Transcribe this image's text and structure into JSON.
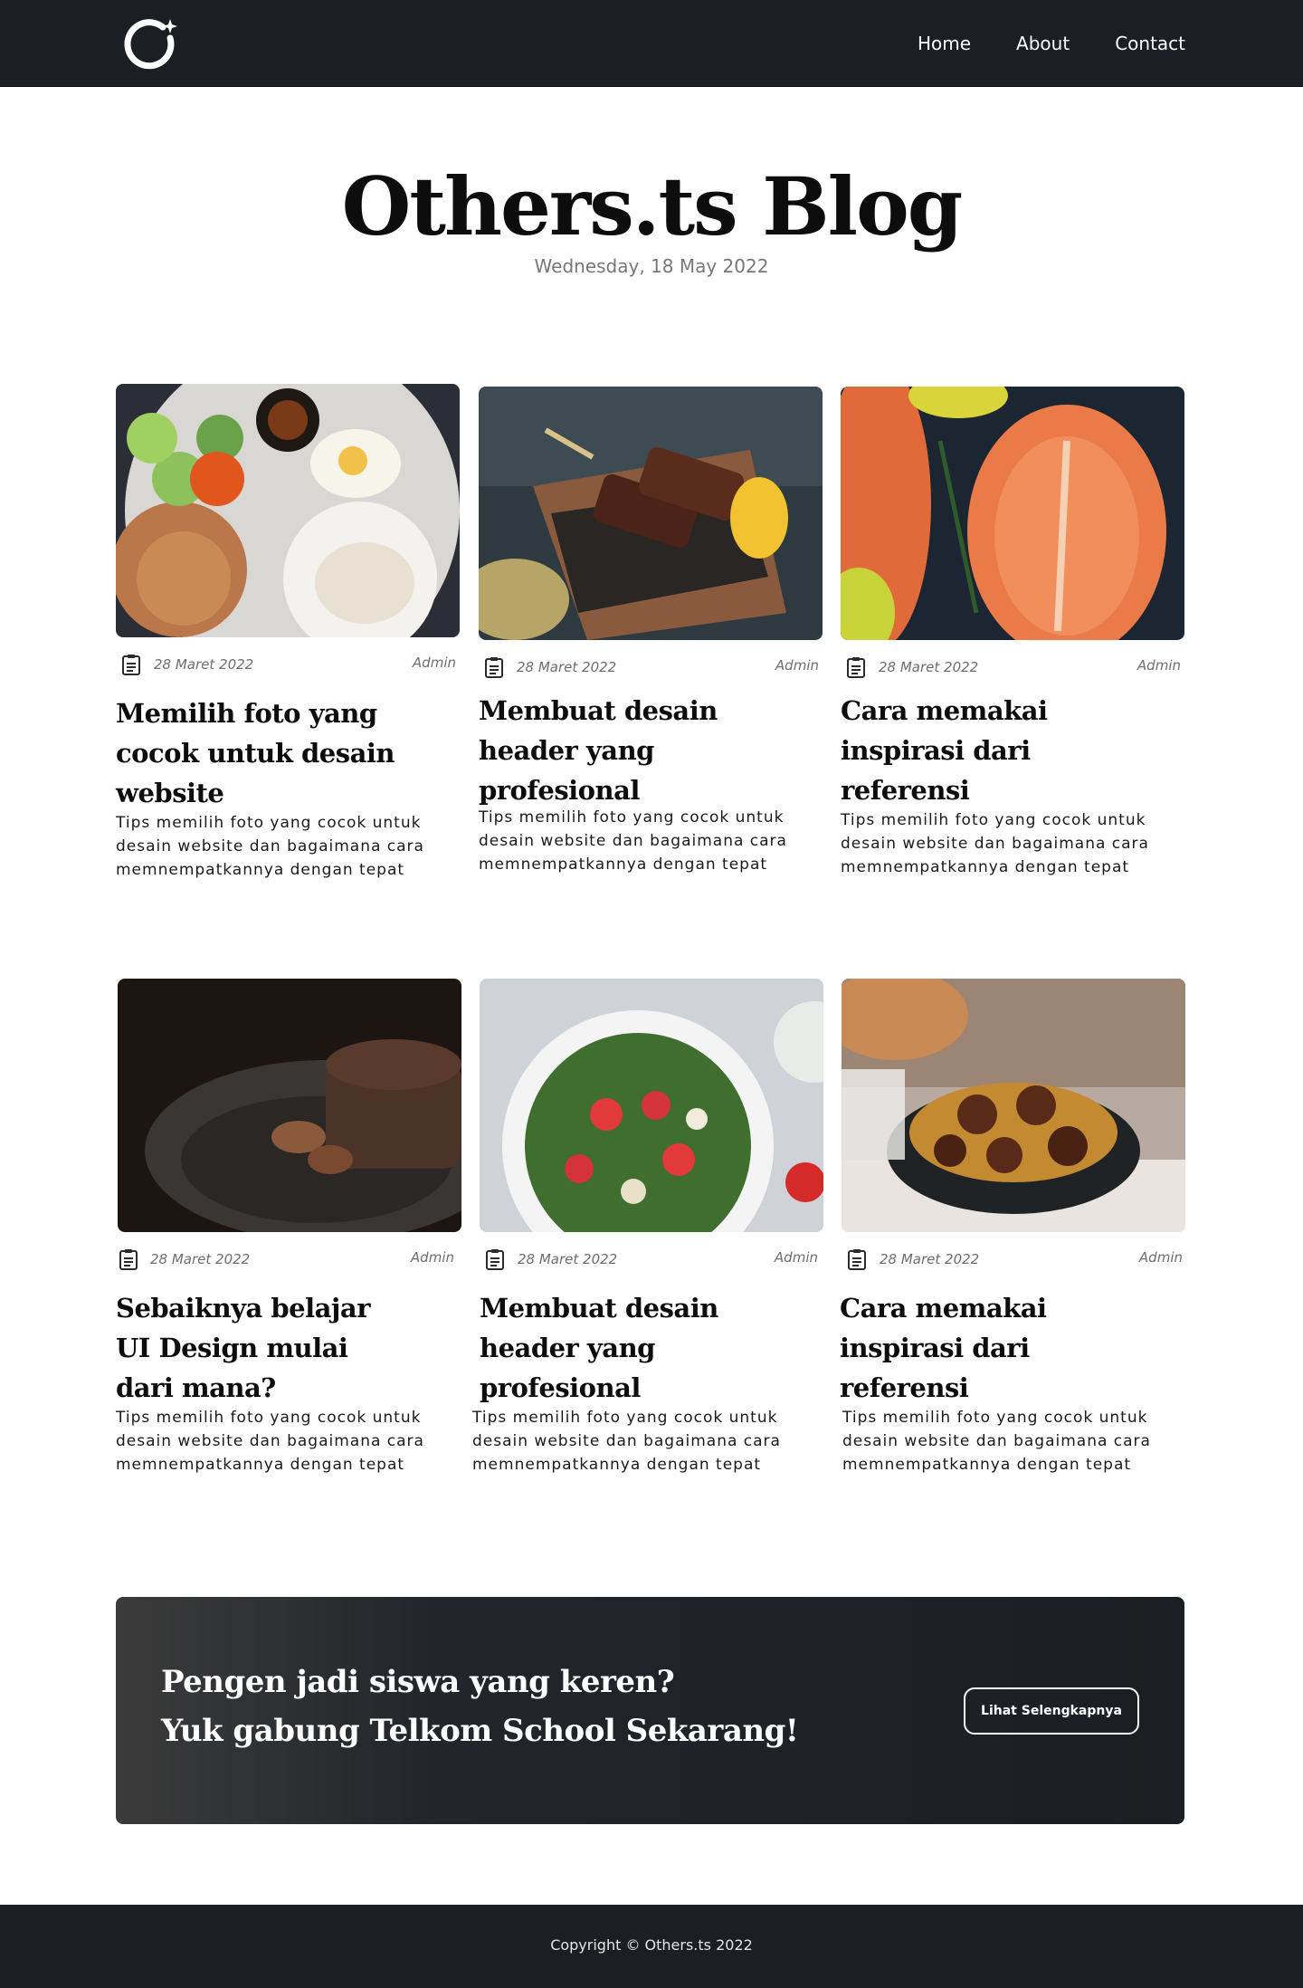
{
  "nav": {
    "logo_icon": "circle-sparkle-logo",
    "links": [
      {
        "label": "Home"
      },
      {
        "label": "About"
      },
      {
        "label": "Contact"
      }
    ]
  },
  "hero": {
    "title": "Others.ts Blog",
    "date": "Wednesday, 18 May 2022"
  },
  "posts": [
    {
      "image": "nasi-goreng-plate-photo",
      "date": "28 Maret 2022",
      "author": "Admin",
      "title": "Memilih foto yang cocok untuk desain website",
      "description": "Tips memilih foto yang cocok untuk desain website dan bagaimana cara memnempatkannya dengan tepat"
    },
    {
      "image": "grilled-satay-photo",
      "date": "28 Maret 2022",
      "author": "Admin",
      "title": "Membuat desain header yang profesional",
      "description": "Tips memilih foto yang cocok untuk desain website dan bagaimana cara memnempatkannya dengan tepat"
    },
    {
      "image": "salmon-steak-photo",
      "date": "28 Maret 2022",
      "author": "Admin",
      "title": "Cara memakai inspirasi dari referensi",
      "description": "Tips memilih foto yang cocok untuk desain website dan bagaimana cara memnempatkannya dengan tepat"
    },
    {
      "image": "chocolate-pancakes-photo",
      "date": "28 Maret 2022",
      "author": "Admin",
      "title": "Sebaiknya belajar UI Design mulai dari mana?",
      "description": "Tips memilih foto yang cocok untuk desain website dan bagaimana cara memnempatkannya dengan tepat"
    },
    {
      "image": "strawberry-salad-photo",
      "date": "28 Maret 2022",
      "author": "Admin",
      "title": "Membuat desain header yang profesional",
      "description": "Tips memilih foto yang cocok untuk desain website dan bagaimana cara memnempatkannya dengan tepat"
    },
    {
      "image": "meatball-noodles-photo",
      "date": "28 Maret 2022",
      "author": "Admin",
      "title": "Cara memakai inspirasi dari referensi",
      "description": "Tips memilih foto yang cocok untuk desain website dan bagaimana cara memnempatkannya dengan tepat"
    }
  ],
  "cta": {
    "line1": "Pengen jadi siswa yang keren?",
    "line2": "Yuk gabung Telkom School Sekarang!",
    "button": "Lihat Selengkapnya"
  },
  "footer": {
    "copyright": "Copyright © Others.ts 2022"
  },
  "colors": {
    "dark": "#1b1e22",
    "text": "#0d0d0d",
    "muted": "#6e6e6e"
  }
}
